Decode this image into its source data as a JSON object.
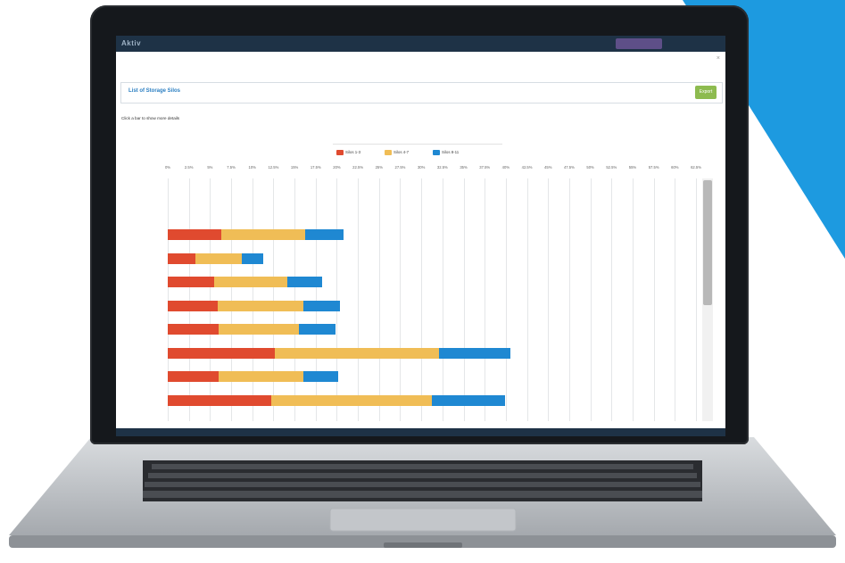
{
  "app": {
    "logo": "Aktiv",
    "nav": [
      "",
      "",
      "",
      ""
    ],
    "close": "×"
  },
  "header": {
    "title": "List of Storage Silos",
    "export_label": "Export"
  },
  "hint": "Click a bar to show more details",
  "legend": [
    {
      "label": "Silos 1-3",
      "color": "#e04a2f"
    },
    {
      "label": "Silos 4-7",
      "color": "#f0bd56"
    },
    {
      "label": "Silos 8-11",
      "color": "#1f88d2"
    }
  ],
  "chart_data": {
    "type": "bar",
    "orientation": "horizontal",
    "stacked": true,
    "xlim": [
      0,
      45
    ],
    "ticks": [
      "0%",
      "2.5%",
      "5%",
      "7.5%",
      "10%",
      "12.5%",
      "15%",
      "17.5%",
      "20%",
      "22.5%",
      "25%",
      "27.5%",
      "30%",
      "32.5%",
      "35%",
      "37.5%",
      "40%",
      "42.5%",
      "45%",
      "47.5%",
      "50%",
      "52.5%",
      "55%",
      "57.5%",
      "60%",
      "62.5%"
    ],
    "categories": [
      "",
      "",
      "",
      "",
      "",
      "",
      "",
      "",
      "",
      ""
    ],
    "series": [
      {
        "name": "Silos 1-3",
        "values": [
          0,
          0,
          6.3,
          3.3,
          5.5,
          5.9,
          6.0,
          12.7,
          6.0,
          12.2
        ]
      },
      {
        "name": "Silos 4-7",
        "values": [
          0,
          0,
          10.0,
          5.5,
          8.6,
          10.1,
          9.5,
          19.4,
          10.1,
          19.1
        ]
      },
      {
        "name": "Silos 8-11",
        "values": [
          0,
          0,
          4.5,
          2.5,
          4.2,
          4.4,
          4.4,
          8.4,
          4.1,
          8.6
        ]
      }
    ]
  },
  "status": {
    "left": "",
    "right": ""
  }
}
